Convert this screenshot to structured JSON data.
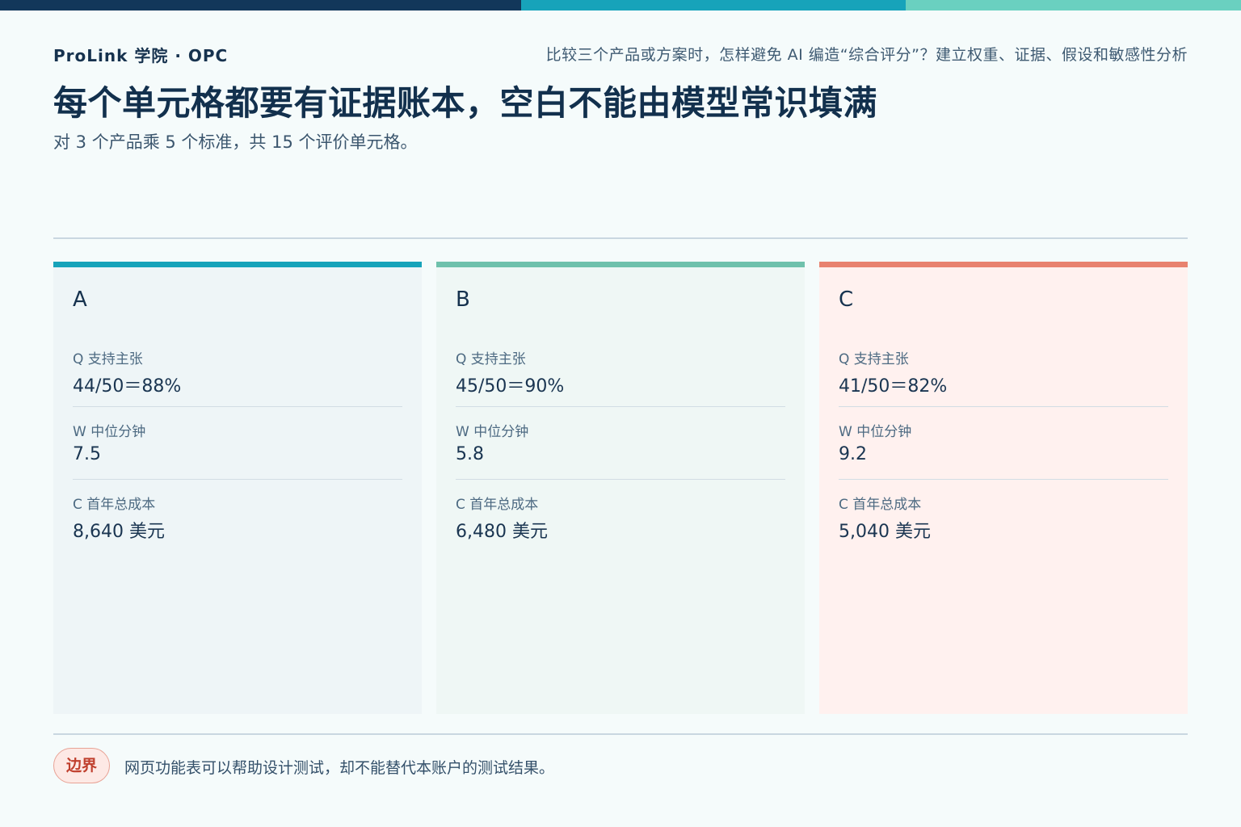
{
  "header": {
    "brand": "ProLink 学院 · OPC",
    "question": "比较三个产品或方案时，怎样避免 AI 编造“综合评分”？建立权重、证据、假设和敏感性分析",
    "headline": "每个单元格都要有证据账本，空白不能由模型常识填满",
    "subhead": "对 3 个产品乘 5 个标准，共 15 个评价单元格。"
  },
  "colors": {
    "topbar": [
      "#12375a",
      "#17a3ba",
      "#6ad0c0"
    ],
    "accent_a": "#17a3ba",
    "accent_b": "#6fc1ac",
    "accent_c": "#e8826f",
    "bg_a": "#eef5f7",
    "bg_b": "#eff7f5",
    "bg_c": "#fff1ef"
  },
  "cards": [
    {
      "title": "A",
      "metrics": [
        {
          "label": "Q 支持主张",
          "value": "44/50＝88%"
        },
        {
          "label": "W 中位分钟",
          "value": "7.5"
        },
        {
          "label": "C 首年总成本",
          "value": "8,640 美元"
        }
      ]
    },
    {
      "title": "B",
      "metrics": [
        {
          "label": "Q 支持主张",
          "value": "45/50＝90%"
        },
        {
          "label": "W 中位分钟",
          "value": "5.8"
        },
        {
          "label": "C 首年总成本",
          "value": "6,480 美元"
        }
      ]
    },
    {
      "title": "C",
      "metrics": [
        {
          "label": "Q 支持主张",
          "value": "41/50＝82%"
        },
        {
          "label": "W 中位分钟",
          "value": "9.2"
        },
        {
          "label": "C 首年总成本",
          "value": "5,040 美元"
        }
      ]
    }
  ],
  "footer": {
    "badge": "边界",
    "text": "网页功能表可以帮助设计测试，却不能替代本账户的测试结果。"
  }
}
